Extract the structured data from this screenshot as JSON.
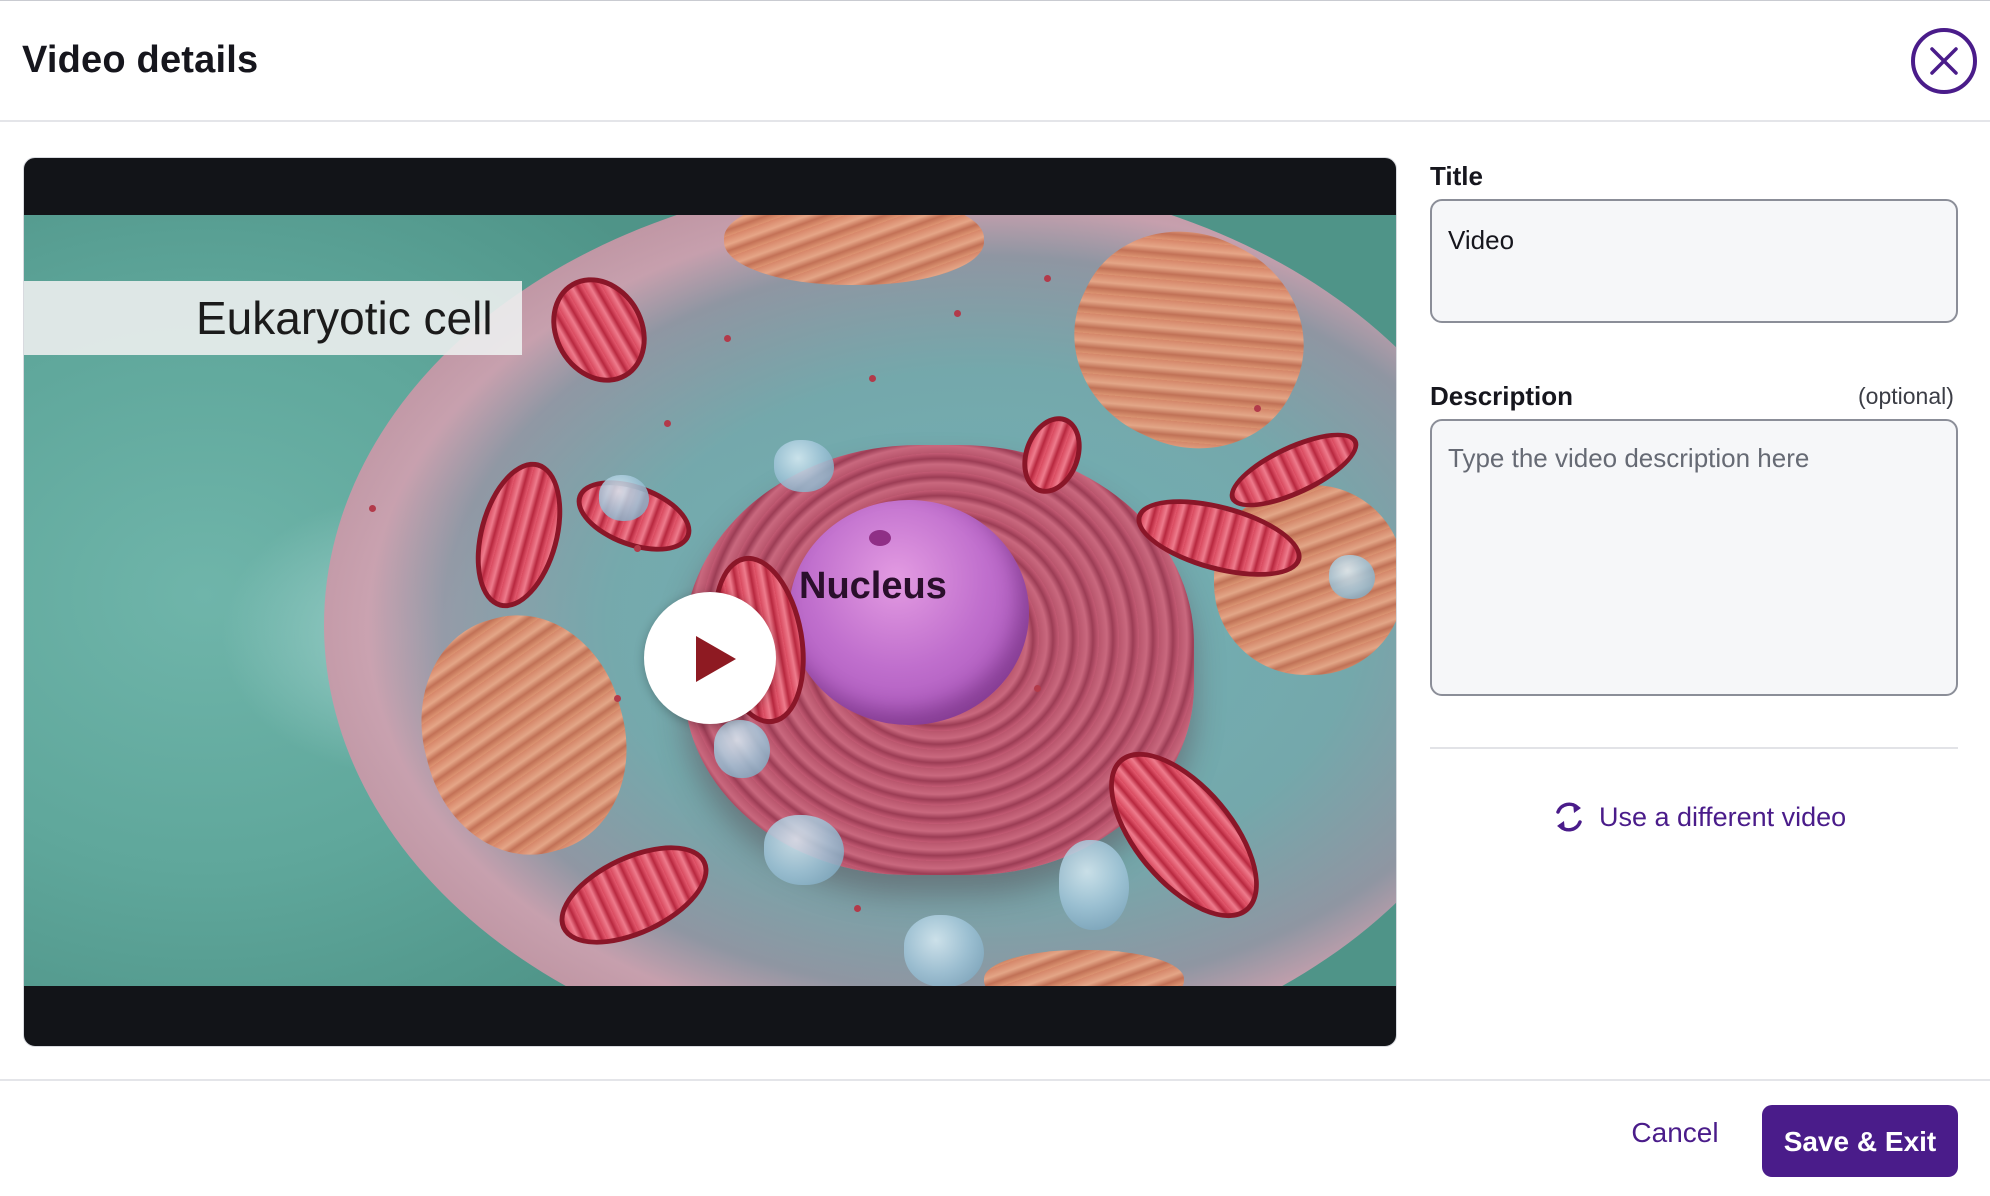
{
  "header": {
    "title": "Video details",
    "close_icon": "close-icon"
  },
  "video": {
    "poster_text": "Eukaryotic cell",
    "nucleus_text": "Nucleus",
    "play_icon": "play-icon"
  },
  "form": {
    "title_label": "Title",
    "title_value": "Video",
    "description_label": "Description",
    "description_optional": "(optional)",
    "description_value": "",
    "description_placeholder": "Type the video description here",
    "change_video_label": "Use a different video",
    "change_video_icon": "refresh-icon"
  },
  "footer": {
    "cancel_label": "Cancel",
    "save_label": "Save & Exit"
  },
  "colors": {
    "accent": "#4a1c8a",
    "input_border": "#8b8e98",
    "input_background": "#f6f7f9",
    "player_background": "#121418"
  }
}
